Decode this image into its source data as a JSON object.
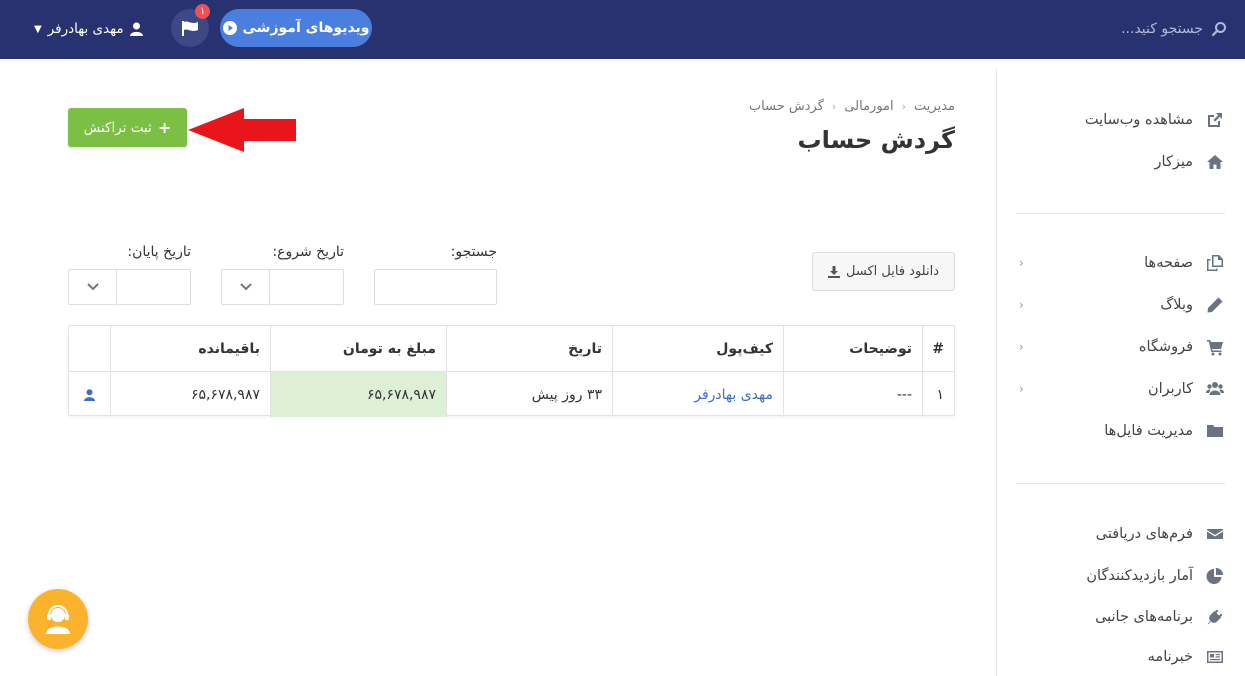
{
  "topbar": {
    "search_placeholder": "جستجو کنید...",
    "user_name": "مهدی بهادرفر",
    "notification_count": "۱",
    "video_button": "ویدیوهای آموزشی"
  },
  "sidebar": {
    "group1": [
      {
        "label": "مشاهده وب‌سایت",
        "icon": "external-link-icon"
      },
      {
        "label": "میزکار",
        "icon": "home-icon"
      }
    ],
    "group2": [
      {
        "label": "صفحه‌ها",
        "icon": "pages-icon"
      },
      {
        "label": "وبلاگ",
        "icon": "pencil-icon"
      },
      {
        "label": "فروشگاه",
        "icon": "cart-icon"
      },
      {
        "label": "کاربران",
        "icon": "users-icon"
      },
      {
        "label": "مدیریت فایل‌ها",
        "icon": "folder-icon"
      }
    ],
    "group3": [
      {
        "label": "فرم‌های دریافتی",
        "icon": "envelope-icon"
      },
      {
        "label": "آمار بازدیدکنندگان",
        "icon": "pie-chart-icon"
      },
      {
        "label": "برنامه‌های جانبی",
        "icon": "plug-icon"
      },
      {
        "label": "خبرنامه",
        "icon": "newspaper-icon"
      }
    ]
  },
  "breadcrumb": [
    "مدیریت",
    "امورمالی",
    "گردش حساب"
  ],
  "page_title": "گردش حساب",
  "add_button": "ثبت تراکنش",
  "excel_button": "دانلود فایل اکسل",
  "filters": {
    "search_label": "جستجو:",
    "start_label": "تاریخ شروع:",
    "end_label": "تاریخ پایان:"
  },
  "table": {
    "headers": [
      "#",
      "توضیحات",
      "کیف‌پول",
      "تاریخ",
      "مبلغ به تومان",
      "باقیمانده",
      ""
    ],
    "rows": [
      {
        "num": "۱",
        "desc": "---",
        "wallet": "مهدی بهادرفر",
        "date": "۳۳ روز پیش",
        "amount": "۶۵,۶۷۸,۹۸۷",
        "balance": "۶۵,۶۷۸,۹۸۷"
      }
    ]
  },
  "colors": {
    "topbar": "#283270",
    "accent_green": "#7cbf45",
    "video_blue": "#4a7fe0",
    "support": "#fbb32e"
  }
}
